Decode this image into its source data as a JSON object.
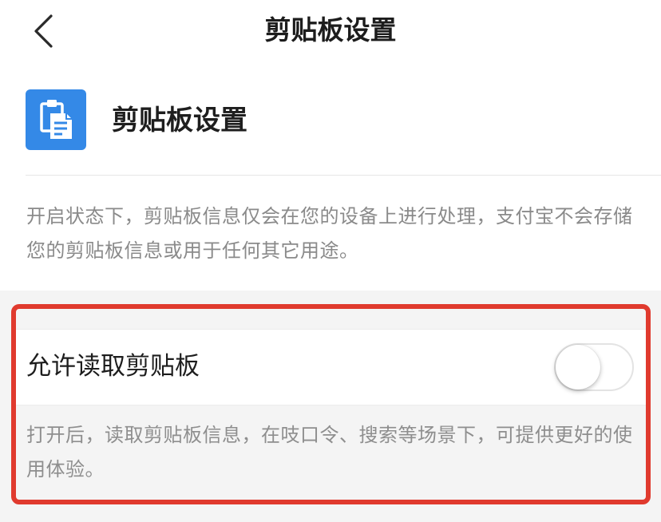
{
  "nav": {
    "title": "剪贴板设置",
    "back_icon": "chevron-left-icon"
  },
  "app": {
    "icon": "clipboard-icon",
    "icon_color": "#3489e7",
    "title": "剪贴板设置"
  },
  "description": "开启状态下，剪贴板信息仅会在您的设备上进行处理，支付宝不会存储您的剪贴板信息或用于任何其它用途。",
  "setting": {
    "label": "允许读取剪贴板",
    "enabled": false,
    "hint": "打开后，读取剪贴板信息，在吱口令、搜索等场景下，可提供更好的使用体验。"
  },
  "colors": {
    "highlight_border": "#e03a2e",
    "background_grey": "#f4f4f4"
  }
}
